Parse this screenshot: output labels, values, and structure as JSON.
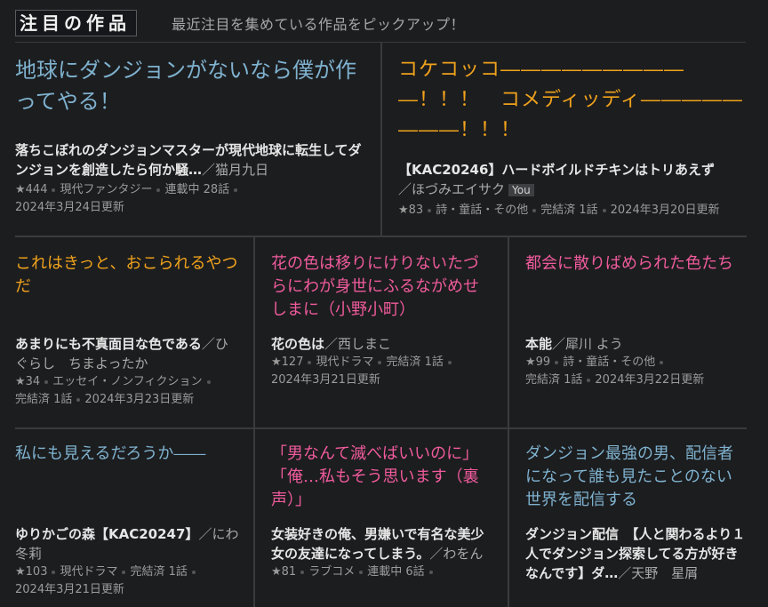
{
  "header": {
    "badge": "注目の作品",
    "tagline": "最近注目を集めている作品をピックアップ！"
  },
  "colors": {
    "blue": "#7fb2cf",
    "orange": "#f0a21c",
    "pink": "#ef5b9c"
  },
  "cards": [
    {
      "title": "地球にダンジョンがないなら僕が作ってやる！",
      "desc": "落ちこぼれのダンジョンマスターが現代地球に転生してダンジョンを創造したら何か騒…",
      "author": "／猫月九日",
      "stars": "★444",
      "genre": "現代ファンタジー",
      "status": "連載中 28話",
      "updated": "2024年3月24日更新"
    },
    {
      "title": "コケコッコ――――――――――！！！　コメディッディ――――――――！！！",
      "desc": "【KAC20246】ハードボイルドチキンはトリあえず",
      "author": "／ほづみエイサク",
      "you_badge": "You",
      "stars": "★83",
      "genre": "詩・童話・その他",
      "status": "完結済 1話",
      "updated": "2024年3月20日更新"
    },
    {
      "title": "これはきっと、おこられるやつだ",
      "desc": "あまりにも不真面目な色である",
      "author": "／ひぐらし　ちまよったか",
      "stars": "★34",
      "genre": "エッセイ・ノンフィクション",
      "status": "完結済 1話",
      "updated": "2024年3月23日更新"
    },
    {
      "title": "花の色は移りにけりないたづらにわが身世にふるながめせしまに（小野小町）",
      "desc": "花の色は",
      "author": "／西しまこ",
      "stars": "★127",
      "genre": "現代ドラマ",
      "status": "完結済 1話",
      "updated": "2024年3月21日更新"
    },
    {
      "title": "都会に散りばめられた色たち",
      "desc": "本能",
      "author": "／犀川 よう",
      "stars": "★99",
      "genre": "詩・童話・その他",
      "status": "完結済 1話",
      "updated": "2024年3月22日更新"
    },
    {
      "title": "私にも見えるだろうか――",
      "desc": "ゆりかごの森【KAC20247】",
      "author": "／にわ冬莉",
      "stars": "★103",
      "genre": "現代ドラマ",
      "status": "完結済 1話",
      "updated": "2024年3月21日更新"
    },
    {
      "title": "「男なんて滅べばいいのに」「俺…私もそう思います（裏声）」",
      "desc": "女装好きの俺、男嫌いで有名な美少女の友達になってしまう。",
      "author": "／わをん",
      "stars": "★81",
      "genre": "ラブコメ",
      "status": "連載中 6話",
      "updated": ""
    },
    {
      "title": "ダンジョン最強の男、配信者になって誰も見たことのない世界を配信する",
      "desc": "ダンジョン配信　【人と関わるより１人でダンジョン探索してる方が好きなんです】ダ…",
      "author": "／天野　星屑",
      "stars": "",
      "genre": "",
      "status": "",
      "updated": ""
    }
  ]
}
